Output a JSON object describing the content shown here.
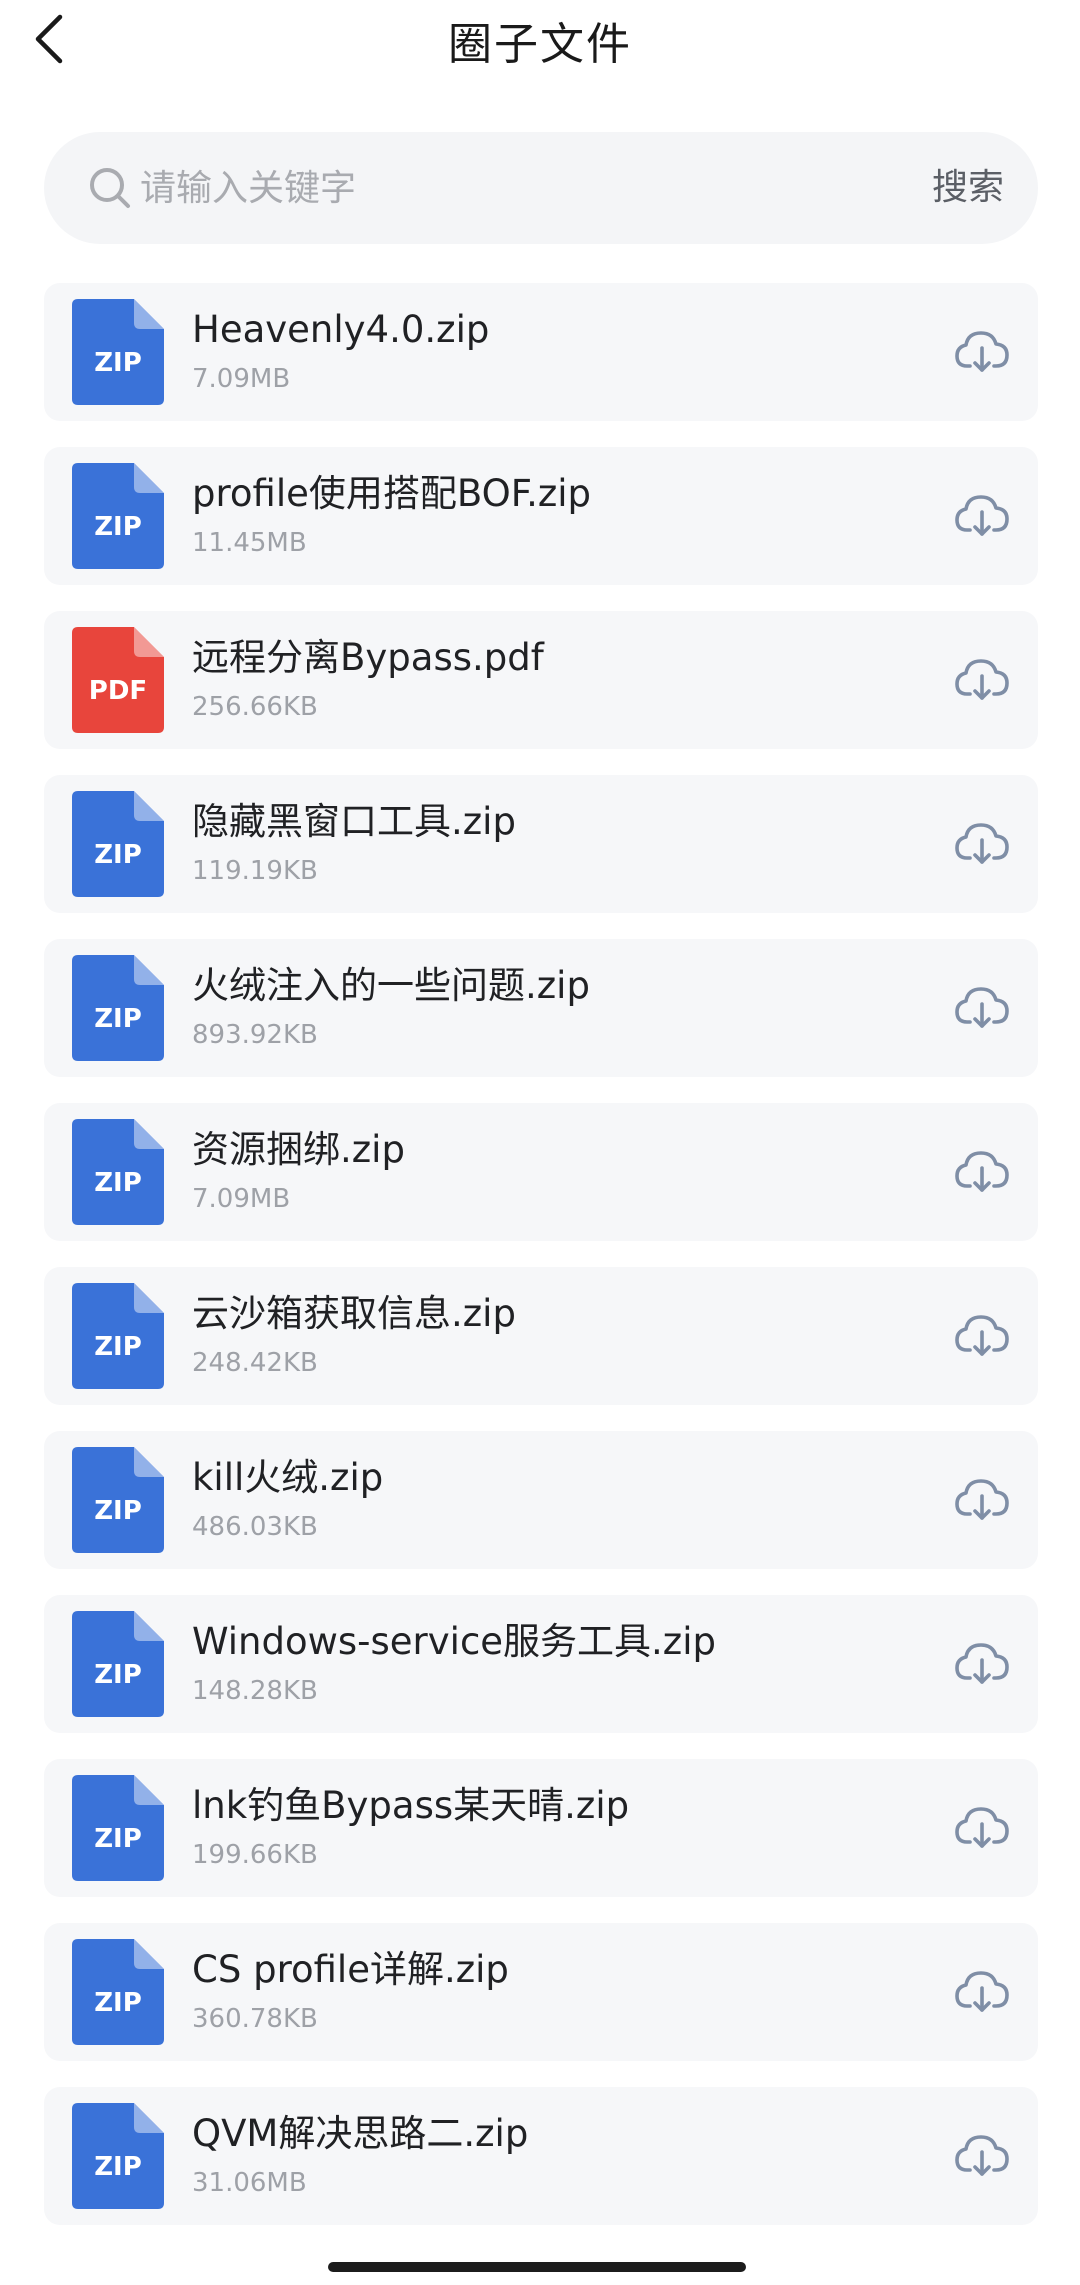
{
  "header": {
    "title": "圈子文件",
    "back_icon": "chevron-left-icon"
  },
  "search": {
    "placeholder": "请输入关键字",
    "value": "",
    "button_label": "搜索",
    "icon": "search-icon"
  },
  "colors": {
    "zip_icon": "#3a72d8",
    "pdf_icon": "#e8453c",
    "card_bg": "#f6f7f9",
    "download_icon": "#7f8ea6"
  },
  "files": [
    {
      "name": "Heavenly4.0.zip",
      "size": "7.09MB",
      "type": "ZIP"
    },
    {
      "name": "profile使用搭配BOF.zip",
      "size": "11.45MB",
      "type": "ZIP"
    },
    {
      "name": "远程分离Bypass.pdf",
      "size": "256.66KB",
      "type": "PDF"
    },
    {
      "name": "隐藏黑窗口工具.zip",
      "size": "119.19KB",
      "type": "ZIP"
    },
    {
      "name": "火绒注入的一些问题.zip",
      "size": "893.92KB",
      "type": "ZIP"
    },
    {
      "name": "资源捆绑.zip",
      "size": "7.09MB",
      "type": "ZIP"
    },
    {
      "name": "云沙箱获取信息.zip",
      "size": "248.42KB",
      "type": "ZIP"
    },
    {
      "name": "kill火绒.zip",
      "size": "486.03KB",
      "type": "ZIP"
    },
    {
      "name": "Windows-service服务工具.zip",
      "size": "148.28KB",
      "type": "ZIP"
    },
    {
      "name": "lnk钓鱼Bypass某天晴.zip",
      "size": "199.66KB",
      "type": "ZIP"
    },
    {
      "name": "CS profile详解.zip",
      "size": "360.78KB",
      "type": "ZIP"
    },
    {
      "name": "QVM解决思路二.zip",
      "size": "31.06MB",
      "type": "ZIP"
    }
  ]
}
